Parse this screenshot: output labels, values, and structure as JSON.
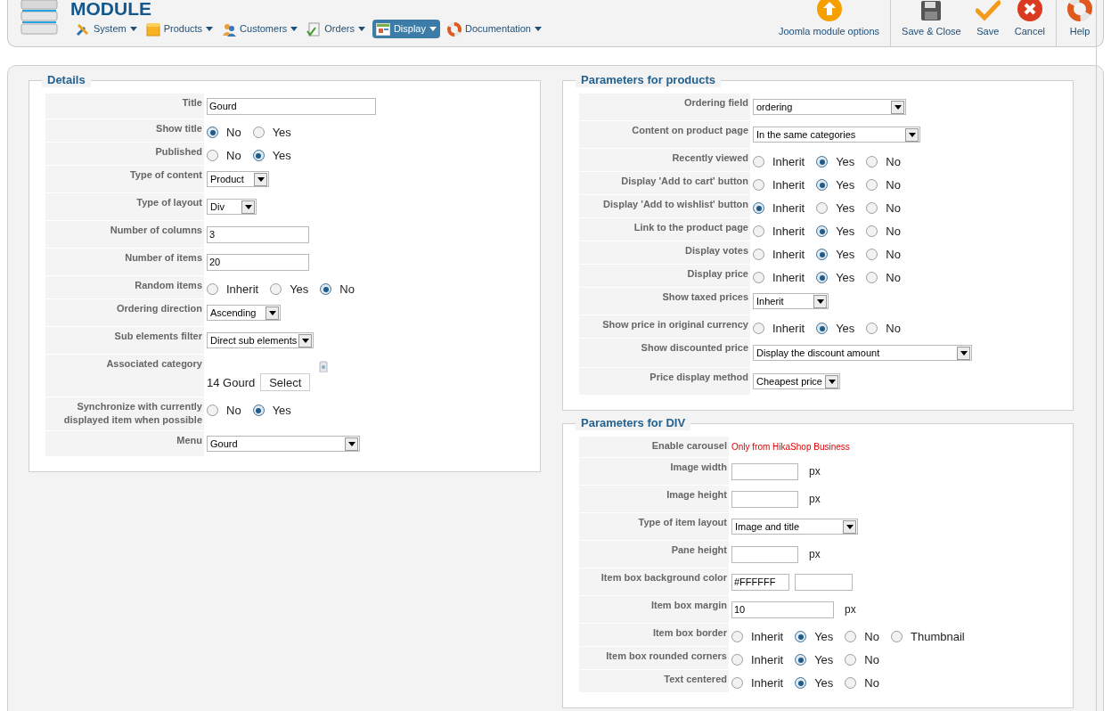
{
  "header": {
    "title": "MODULE"
  },
  "menu": [
    {
      "label": "System",
      "selected": false
    },
    {
      "label": "Products",
      "selected": false
    },
    {
      "label": "Customers",
      "selected": false
    },
    {
      "label": "Orders",
      "selected": false
    },
    {
      "label": "Display",
      "selected": true
    },
    {
      "label": "Documentation",
      "selected": false
    }
  ],
  "toolbar": [
    {
      "label": "Joomla module options"
    },
    {
      "label": "Save & Close"
    },
    {
      "label": "Save"
    },
    {
      "label": "Cancel"
    },
    {
      "label": "Help"
    }
  ],
  "sections": [
    {
      "legend": "Details",
      "rows": [
        {
          "label": "Title",
          "kind": "text",
          "value": "Gourd"
        },
        {
          "label": "Show title",
          "kind": "radio",
          "options": [
            {
              "label": "No",
              "selected": true
            },
            {
              "label": "Yes",
              "selected": false
            }
          ]
        },
        {
          "label": "Published",
          "kind": "radio",
          "options": [
            {
              "label": "No",
              "selected": false
            },
            {
              "label": "Yes",
              "selected": true
            }
          ]
        },
        {
          "label": "Type of content",
          "kind": "select",
          "value": "Product"
        },
        {
          "label": "Type of layout",
          "kind": "select",
          "value": "Div"
        },
        {
          "label": "Number of columns",
          "kind": "text",
          "value": "3"
        },
        {
          "label": "Number of items",
          "kind": "text",
          "value": "20"
        },
        {
          "label": "Random items",
          "kind": "radio",
          "options": [
            {
              "label": "Inherit",
              "selected": false
            },
            {
              "label": "Yes",
              "selected": false
            },
            {
              "label": "No",
              "selected": true
            }
          ]
        },
        {
          "label": "Ordering direction",
          "kind": "select",
          "value": "Ascending"
        },
        {
          "label": "Sub elements filter",
          "kind": "select",
          "value": "Direct sub elements"
        },
        {
          "label": "Associated category",
          "kind": "category",
          "value": "14 Gourd",
          "button": "Select"
        },
        {
          "label": "Synchronize with currently displayed item when possible",
          "kind": "radio",
          "options": [
            {
              "label": "No",
              "selected": false
            },
            {
              "label": "Yes",
              "selected": true
            }
          ]
        },
        {
          "label": "Menu",
          "kind": "select",
          "value": "Gourd"
        }
      ]
    },
    {
      "legend": "Parameters for products",
      "rows": [
        {
          "label": "Ordering field",
          "kind": "select",
          "value": "ordering"
        },
        {
          "label": "Content on product page",
          "kind": "select",
          "value": "In the same categories"
        },
        {
          "label": "Recently viewed",
          "kind": "radio",
          "options": [
            {
              "label": "Inherit",
              "selected": false
            },
            {
              "label": "Yes",
              "selected": true
            },
            {
              "label": "No",
              "selected": false
            }
          ]
        },
        {
          "label": "Display 'Add to cart' button",
          "kind": "radio",
          "options": [
            {
              "label": "Inherit",
              "selected": false
            },
            {
              "label": "Yes",
              "selected": true
            },
            {
              "label": "No",
              "selected": false
            }
          ]
        },
        {
          "label": "Display 'Add to wishlist' button",
          "kind": "radio",
          "options": [
            {
              "label": "Inherit",
              "selected": true
            },
            {
              "label": "Yes",
              "selected": false
            },
            {
              "label": "No",
              "selected": false
            }
          ]
        },
        {
          "label": "Link to the product page",
          "kind": "radio",
          "options": [
            {
              "label": "Inherit",
              "selected": false
            },
            {
              "label": "Yes",
              "selected": true
            },
            {
              "label": "No",
              "selected": false
            }
          ]
        },
        {
          "label": "Display votes",
          "kind": "radio",
          "options": [
            {
              "label": "Inherit",
              "selected": false
            },
            {
              "label": "Yes",
              "selected": true
            },
            {
              "label": "No",
              "selected": false
            }
          ]
        },
        {
          "label": "Display price",
          "kind": "radio",
          "options": [
            {
              "label": "Inherit",
              "selected": false
            },
            {
              "label": "Yes",
              "selected": true
            },
            {
              "label": "No",
              "selected": false
            }
          ]
        },
        {
          "label": "Show taxed prices",
          "kind": "select",
          "value": "Inherit"
        },
        {
          "label": "Show price in original currency",
          "kind": "radio",
          "options": [
            {
              "label": "Inherit",
              "selected": false
            },
            {
              "label": "Yes",
              "selected": true
            },
            {
              "label": "No",
              "selected": false
            }
          ]
        },
        {
          "label": "Show discounted price",
          "kind": "select",
          "value": "Display the discount amount"
        },
        {
          "label": "Price display method",
          "kind": "select",
          "value": "Cheapest price"
        }
      ]
    },
    {
      "legend": "Parameters for DIV",
      "rows": [
        {
          "label": "Enable carousel",
          "kind": "note",
          "value": "Only from HikaShop Business"
        },
        {
          "label": "Image width",
          "kind": "text",
          "unit": "px"
        },
        {
          "label": "Image height",
          "kind": "text",
          "unit": "px"
        },
        {
          "label": "Type of item layout",
          "kind": "select",
          "value": "Image and title"
        },
        {
          "label": "Pane height",
          "kind": "text",
          "unit": "px"
        },
        {
          "label": "Item box background color",
          "kind": "color",
          "value": "#FFFFFF"
        },
        {
          "label": "Item box margin",
          "kind": "text",
          "value": "10",
          "unit": "px"
        },
        {
          "label": "Item box border",
          "kind": "radio",
          "options": [
            {
              "label": "Inherit",
              "selected": false
            },
            {
              "label": "Yes",
              "selected": true
            },
            {
              "label": "No",
              "selected": false
            },
            {
              "label": "Thumbnail",
              "selected": false
            }
          ]
        },
        {
          "label": "Item box rounded corners",
          "kind": "radio",
          "options": [
            {
              "label": "Inherit",
              "selected": false
            },
            {
              "label": "Yes",
              "selected": true
            },
            {
              "label": "No",
              "selected": false
            }
          ]
        },
        {
          "label": "Text centered",
          "kind": "radio",
          "options": [
            {
              "label": "Inherit",
              "selected": false
            },
            {
              "label": "Yes",
              "selected": true
            },
            {
              "label": "No",
              "selected": false
            }
          ]
        }
      ]
    }
  ]
}
